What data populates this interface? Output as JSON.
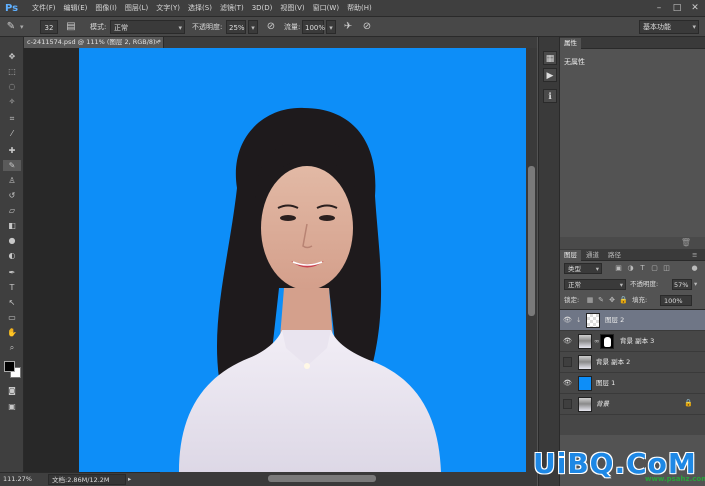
{
  "app": {
    "logo": "Ps"
  },
  "menu": [
    "文件(F)",
    "编辑(E)",
    "图像(I)",
    "图层(L)",
    "文字(Y)",
    "选择(S)",
    "滤镜(T)",
    "3D(D)",
    "视图(V)",
    "窗口(W)",
    "帮助(H)"
  ],
  "options": {
    "brush_size": "32",
    "mode_label": "模式:",
    "mode_value": "正常",
    "opacity_label": "不透明度:",
    "opacity_value": "25%",
    "flow_label": "流量:",
    "flow_value": "100%",
    "workspace": "基本功能"
  },
  "document": {
    "tab_title": "c-2411574.psd @ 111% (图层 2, RGB/8) *",
    "zoom": "111.27%",
    "doc_info": "文档:2.86M/12.2M"
  },
  "properties": {
    "tab": "属性",
    "text": "无属性"
  },
  "layers_panel": {
    "tabs": [
      "图层",
      "通道",
      "路径"
    ],
    "filter_kind": "类型",
    "blend_mode": "正常",
    "opacity_label": "不透明度:",
    "opacity_value": "57%",
    "lock_label": "锁定:",
    "fill_label": "填充:",
    "fill_value": "100%",
    "layers": [
      {
        "name": "图层 2",
        "visible": true,
        "selected": true
      },
      {
        "name": "背景 副本 3",
        "visible": true,
        "selected": false
      },
      {
        "name": "背景 副本 2",
        "visible": false,
        "selected": false
      },
      {
        "name": "图层 1",
        "visible": true,
        "selected": false
      },
      {
        "name": "背景",
        "visible": false,
        "selected": false
      }
    ]
  },
  "watermark": {
    "main": "UiBQ.CoM",
    "sub": "www.psahz.com"
  },
  "colors": {
    "canvas_blue": "#0d8ef8",
    "selected_layer": "#6f7686"
  }
}
